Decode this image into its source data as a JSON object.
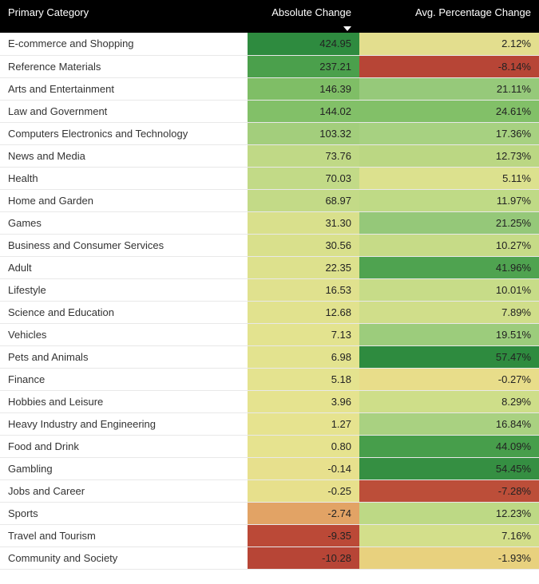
{
  "header": {
    "col_category": "Primary Category",
    "col_absolute": "Absolute Change",
    "col_percent": "Avg. Percentage Change",
    "sorted_column": "absolute",
    "sort_direction": "desc"
  },
  "chart_data": {
    "type": "table",
    "title": "",
    "columns": [
      "Primary Category",
      "Absolute Change",
      "Avg. Percentage Change"
    ],
    "color_scale": {
      "min": "#B74536",
      "mid": "#E7E090",
      "max": "#2E8B3F"
    },
    "rows": [
      {
        "category": "E-commerce and Shopping",
        "absolute": 424.95,
        "absolute_text": "424.95",
        "percent": 2.12,
        "percent_text": "2.12%",
        "abs_color": "#2E8B3F",
        "pct_color": "#E3DE8E"
      },
      {
        "category": "Reference Materials",
        "absolute": 237.21,
        "absolute_text": "237.21",
        "percent": -8.14,
        "percent_text": "-8.14%",
        "abs_color": "#4BA04C",
        "pct_color": "#B74536"
      },
      {
        "category": "Arts and Entertainment",
        "absolute": 146.39,
        "absolute_text": "146.39",
        "percent": 21.11,
        "percent_text": "21.11%",
        "abs_color": "#7FBE66",
        "pct_color": "#96C97A"
      },
      {
        "category": "Law and Government",
        "absolute": 144.02,
        "absolute_text": "144.02",
        "percent": 24.61,
        "percent_text": "24.61%",
        "abs_color": "#82C068",
        "pct_color": "#82C068"
      },
      {
        "category": "Computers Electronics and Technology",
        "absolute": 103.32,
        "absolute_text": "103.32",
        "percent": 17.36,
        "percent_text": "17.36%",
        "abs_color": "#A3CE7C",
        "pct_color": "#A7D181"
      },
      {
        "category": "News and Media",
        "absolute": 73.76,
        "absolute_text": "73.76",
        "percent": 12.73,
        "percent_text": "12.73%",
        "abs_color": "#C0D986",
        "pct_color": "#BBD783"
      },
      {
        "category": "Health",
        "absolute": 70.03,
        "absolute_text": "70.03",
        "percent": 5.11,
        "percent_text": "5.11%",
        "abs_color": "#C2DA87",
        "pct_color": "#DCE18E"
      },
      {
        "category": "Home and Garden",
        "absolute": 68.97,
        "absolute_text": "68.97",
        "percent": 11.97,
        "percent_text": "11.97%",
        "abs_color": "#C3DA87",
        "pct_color": "#BFDA86"
      },
      {
        "category": "Games",
        "absolute": 31.3,
        "absolute_text": "31.30",
        "percent": 21.25,
        "percent_text": "21.25%",
        "abs_color": "#D9E08C",
        "pct_color": "#95C879"
      },
      {
        "category": "Business and Consumer Services",
        "absolute": 30.56,
        "absolute_text": "30.56",
        "percent": 10.27,
        "percent_text": "10.27%",
        "abs_color": "#D9E08C",
        "pct_color": "#C6DB87"
      },
      {
        "category": "Adult",
        "absolute": 22.35,
        "absolute_text": "22.35",
        "percent": 41.96,
        "percent_text": "41.96%",
        "abs_color": "#DDE18D",
        "pct_color": "#4FA350"
      },
      {
        "category": "Lifestyle",
        "absolute": 16.53,
        "absolute_text": "16.53",
        "percent": 10.01,
        "percent_text": "10.01%",
        "abs_color": "#E0E18E",
        "pct_color": "#C7DC88"
      },
      {
        "category": "Science and Education",
        "absolute": 12.68,
        "absolute_text": "12.68",
        "percent": 7.89,
        "percent_text": "7.89%",
        "abs_color": "#E1E28E",
        "pct_color": "#D0DE8A"
      },
      {
        "category": "Vehicles",
        "absolute": 7.13,
        "absolute_text": "7.13",
        "percent": 19.51,
        "percent_text": "19.51%",
        "abs_color": "#E3E38F",
        "pct_color": "#9CCC7C"
      },
      {
        "category": "Pets and Animals",
        "absolute": 6.98,
        "absolute_text": "6.98",
        "percent": 57.47,
        "percent_text": "57.47%",
        "abs_color": "#E3E38F",
        "pct_color": "#2E8B3F"
      },
      {
        "category": "Finance",
        "absolute": 5.18,
        "absolute_text": "5.18",
        "percent": -0.27,
        "percent_text": "-0.27%",
        "abs_color": "#E4E38F",
        "pct_color": "#E8DD8A"
      },
      {
        "category": "Hobbies and Leisure",
        "absolute": 3.96,
        "absolute_text": "3.96",
        "percent": 8.29,
        "percent_text": "8.29%",
        "abs_color": "#E5E38F",
        "pct_color": "#CEDE89"
      },
      {
        "category": "Heavy Industry and Engineering",
        "absolute": 1.27,
        "absolute_text": "1.27",
        "percent": 16.84,
        "percent_text": "16.84%",
        "abs_color": "#E6E38F",
        "pct_color": "#A9D181"
      },
      {
        "category": "Food and Drink",
        "absolute": 0.8,
        "absolute_text": "0.80",
        "percent": 44.09,
        "percent_text": "44.09%",
        "abs_color": "#E6E38F",
        "pct_color": "#479E4B"
      },
      {
        "category": "Gambling",
        "absolute": -0.14,
        "absolute_text": "-0.14",
        "percent": 54.45,
        "percent_text": "54.45%",
        "abs_color": "#E7E08D",
        "pct_color": "#358F42"
      },
      {
        "category": "Jobs and Career",
        "absolute": -0.25,
        "absolute_text": "-0.25",
        "percent": -7.28,
        "percent_text": "-7.28%",
        "abs_color": "#E7E08C",
        "pct_color": "#BC4E39"
      },
      {
        "category": "Sports",
        "absolute": -2.74,
        "absolute_text": "-2.74",
        "percent": 12.23,
        "percent_text": "12.23%",
        "abs_color": "#E2A365",
        "pct_color": "#BDD985"
      },
      {
        "category": "Travel and Tourism",
        "absolute": -9.35,
        "absolute_text": "-9.35",
        "percent": 7.16,
        "percent_text": "7.16%",
        "abs_color": "#BB4937",
        "pct_color": "#D3DF8B"
      },
      {
        "category": "Community and Society",
        "absolute": -10.28,
        "absolute_text": "-10.28",
        "percent": -1.93,
        "percent_text": "-1.93%",
        "abs_color": "#B74536",
        "pct_color": "#E8D17E"
      }
    ]
  }
}
